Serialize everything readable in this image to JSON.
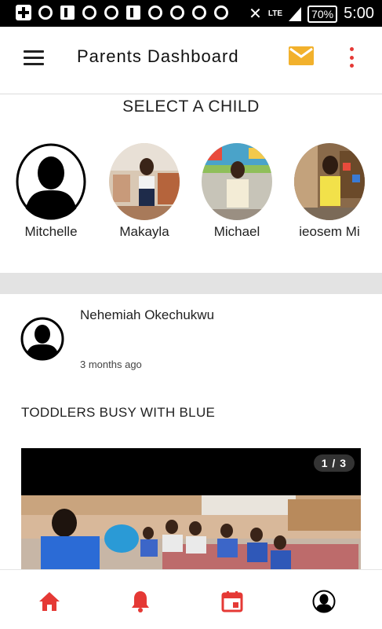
{
  "status_bar": {
    "battery": "70%",
    "time": "5:00",
    "network": "LTE"
  },
  "app_bar": {
    "title": "Parents Dashboard",
    "icons": [
      "menu-icon",
      "mail-icon",
      "more-vert-icon"
    ],
    "accent_color": "#e53935",
    "mail_color": "#f2b12c"
  },
  "child_selector": {
    "title": "SELECT A CHILD",
    "children": [
      {
        "name": "Mitchelle",
        "photo": "placeholder-avatar"
      },
      {
        "name": "Makayla",
        "photo": "child-photo"
      },
      {
        "name": "Michael",
        "photo": "child-photo"
      },
      {
        "name": "ieosem Mi",
        "photo": "child-photo"
      }
    ]
  },
  "post": {
    "author": "Nehemiah Okechukwu",
    "time": "3 months ago",
    "title": "TODDLERS BUSY WITH BLUE",
    "image_counter": "1 / 3"
  },
  "bottom_nav": {
    "items": [
      "home-icon",
      "bell-icon",
      "calendar-icon",
      "profile-icon"
    ],
    "color": "#e53935"
  }
}
